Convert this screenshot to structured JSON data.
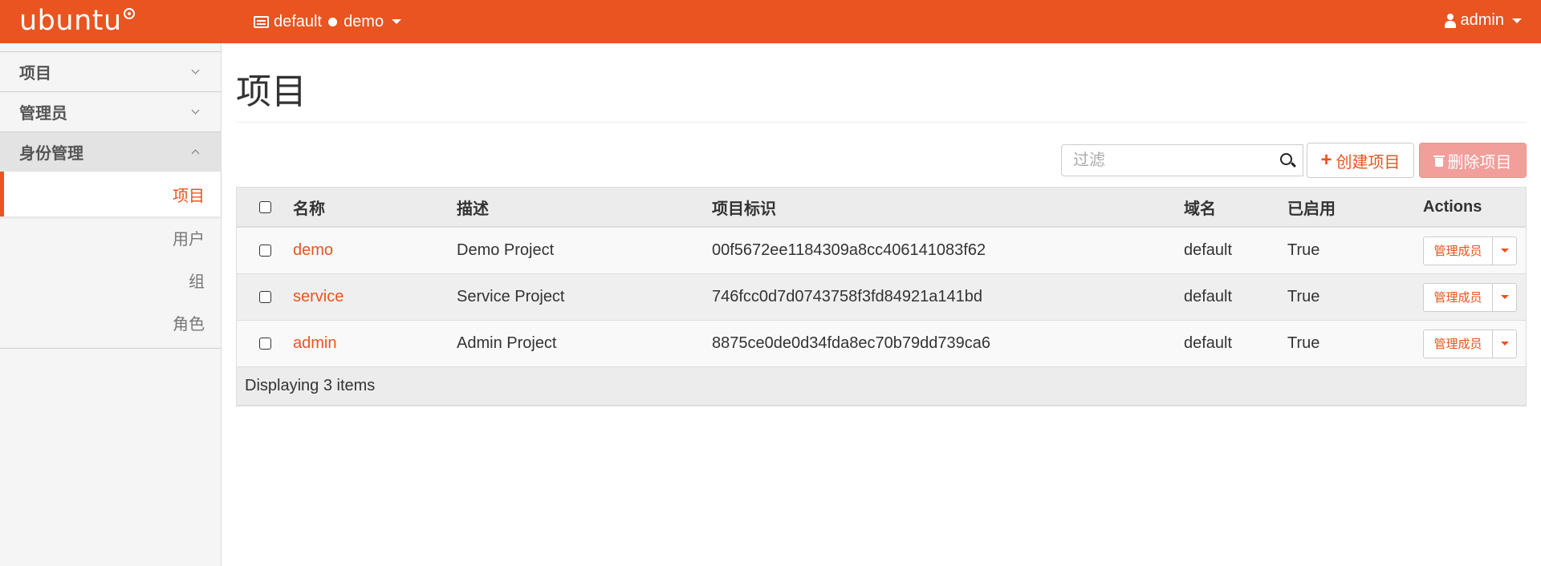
{
  "header": {
    "logo": "ubuntu",
    "context_domain": "default",
    "context_project": "demo",
    "user": "admin",
    "brand_color": "#e95420"
  },
  "sidebar": {
    "sections": [
      {
        "label": "项目",
        "expanded": false
      },
      {
        "label": "管理员",
        "expanded": false
      },
      {
        "label": "身份管理",
        "expanded": true
      }
    ],
    "items": [
      {
        "label": "项目",
        "active": true
      },
      {
        "label": "用户",
        "active": false
      },
      {
        "label": "组",
        "active": false
      },
      {
        "label": "角色",
        "active": false
      }
    ]
  },
  "main": {
    "title": "项目",
    "filter_placeholder": "过滤",
    "create_label": "创建项目",
    "delete_label": "删除项目"
  },
  "table": {
    "columns": [
      "名称",
      "描述",
      "项目标识",
      "域名",
      "已启用",
      "Actions"
    ],
    "rows": [
      {
        "name": "demo",
        "description": "Demo Project",
        "id": "00f5672ee1184309a8cc406141083f62",
        "domain": "default",
        "enabled": "True",
        "action": "管理成员"
      },
      {
        "name": "service",
        "description": "Service Project",
        "id": "746fcc0d7d0743758f3fd84921a141bd",
        "domain": "default",
        "enabled": "True",
        "action": "管理成员"
      },
      {
        "name": "admin",
        "description": "Admin Project",
        "id": "8875ce0de0d34fda8ec70b79dd739ca6",
        "domain": "default",
        "enabled": "True",
        "action": "管理成员"
      }
    ],
    "footer": "Displaying 3 items"
  }
}
